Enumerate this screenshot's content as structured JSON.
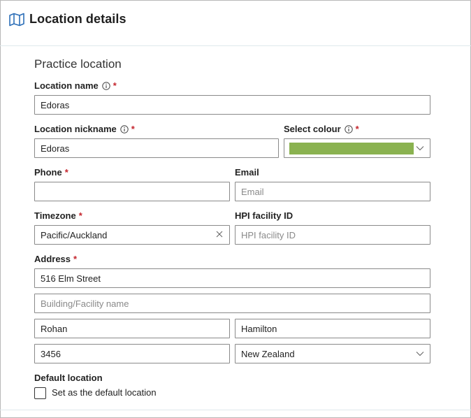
{
  "header": {
    "title": "Location details",
    "icon": "map-icon"
  },
  "section": {
    "title": "Practice location"
  },
  "fields": {
    "location_name": {
      "label": "Location name",
      "required_mark": "*",
      "value": "Edoras"
    },
    "location_nickname": {
      "label": "Location nickname",
      "required_mark": "*",
      "value": "Edoras"
    },
    "select_colour": {
      "label": "Select colour",
      "required_mark": "*",
      "color": "#8ab250"
    },
    "phone": {
      "label": "Phone",
      "required_mark": "*",
      "value": ""
    },
    "email": {
      "label": "Email",
      "value": "",
      "placeholder": "Email"
    },
    "timezone": {
      "label": "Timezone",
      "required_mark": "*",
      "value": "Pacific/Auckland"
    },
    "hpi_facility_id": {
      "label": "HPI facility ID",
      "value": "",
      "placeholder": "HPI facility ID"
    },
    "address": {
      "label": "Address",
      "required_mark": "*",
      "street": "516 Elm Street",
      "building_placeholder": "Building/Facility name",
      "suburb": "Rohan",
      "city": "Hamilton",
      "postcode": "3456",
      "country": "New Zealand"
    },
    "default_location": {
      "label": "Default location",
      "checkbox_label": "Set as the default location",
      "checked": false
    }
  }
}
